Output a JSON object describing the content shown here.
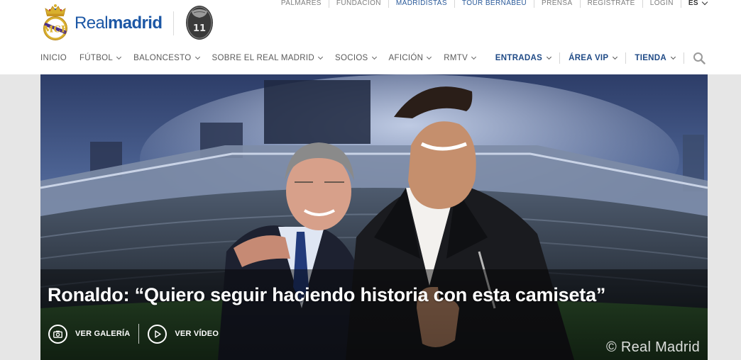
{
  "top_links": [
    {
      "label": "PALMARES",
      "highlight": false
    },
    {
      "label": "FUNDACION",
      "highlight": false
    },
    {
      "label": "MADRIDISTAS",
      "highlight": true
    },
    {
      "label": "TOUR BERNABEU",
      "highlight": true
    },
    {
      "label": "PRENSA",
      "highlight": false
    },
    {
      "label": "REGISTRATE",
      "highlight": false
    },
    {
      "label": "LOGIN",
      "highlight": false
    }
  ],
  "language": "ES",
  "brand": {
    "part1": "Real",
    "part2": "madrid",
    "badge_number": "11"
  },
  "main_nav": [
    "INICIO",
    "FÚTBOL",
    "BALONCESTO",
    "SOBRE EL REAL MADRID",
    "SOCIOS",
    "AFICIÓN",
    "RMTV"
  ],
  "main_nav_has_dropdown": [
    false,
    true,
    true,
    true,
    true,
    true,
    true
  ],
  "right_nav": [
    "ENTRADAS",
    "ÁREA VIP",
    "TIENDA"
  ],
  "hero": {
    "headline": "Ronaldo: “Quiero seguir haciendo historia con esta camiseta”",
    "gallery_label": "VER GALERÍA",
    "video_label": "VER VÍDEO",
    "watermark": "© Real Madrid"
  },
  "colors": {
    "brand_blue": "#1c57a5",
    "nav_blue": "#1f4a86",
    "link_blue": "#2a5a9a",
    "nav_gray": "#5a5a5a"
  },
  "icons": [
    "search-icon",
    "camera-icon",
    "play-icon",
    "chevron-down-icon"
  ]
}
